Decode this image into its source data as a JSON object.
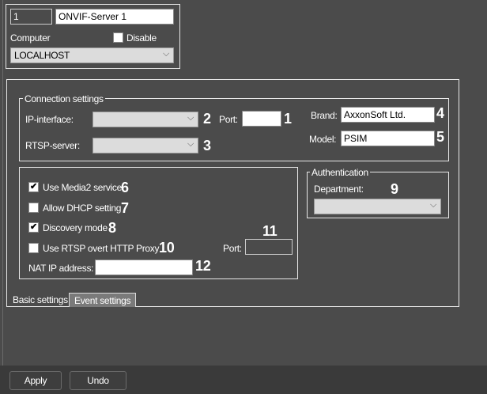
{
  "header": {
    "id": "1",
    "name": "ONVIF-Server 1",
    "computer_label": "Computer",
    "disable_label": "Disable",
    "disable_checked": false,
    "computer_value": "LOCALHOST"
  },
  "connection": {
    "title": "Connection settings",
    "ip_label": "IP-interface:",
    "ip_value": "",
    "port_label": "Port:",
    "port_value": "",
    "rtsp_label": "RTSP-server:",
    "rtsp_value": "",
    "brand_label": "Brand:",
    "brand_value": "AxxonSoft Ltd.",
    "model_label": "Model:",
    "model_value": "PSIM"
  },
  "options": {
    "media2": "Use Media2 service",
    "media2_checked": true,
    "dhcp": "Allow DHCP setting",
    "dhcp_checked": false,
    "discovery": "Discovery mode",
    "discovery_checked": true,
    "rtsp_proxy": "Use RTSP overt HTTP Proxy",
    "rtsp_proxy_checked": false,
    "port_label": "Port:",
    "port_value": "",
    "nat_label": "NAT IP address:",
    "nat_value": ""
  },
  "auth": {
    "title": "Authentication",
    "department_label": "Department:",
    "department_value": ""
  },
  "callouts": [
    "1",
    "2",
    "3",
    "4",
    "5",
    "6",
    "7",
    "8",
    "9",
    "10",
    "11",
    "12"
  ],
  "tabs": [
    {
      "label": "Basic settings"
    },
    {
      "label": "Event settings"
    }
  ],
  "footer": {
    "apply": "Apply",
    "undo": "Undo"
  },
  "icons": {
    "chevron": "⌵",
    "check": "✔"
  }
}
